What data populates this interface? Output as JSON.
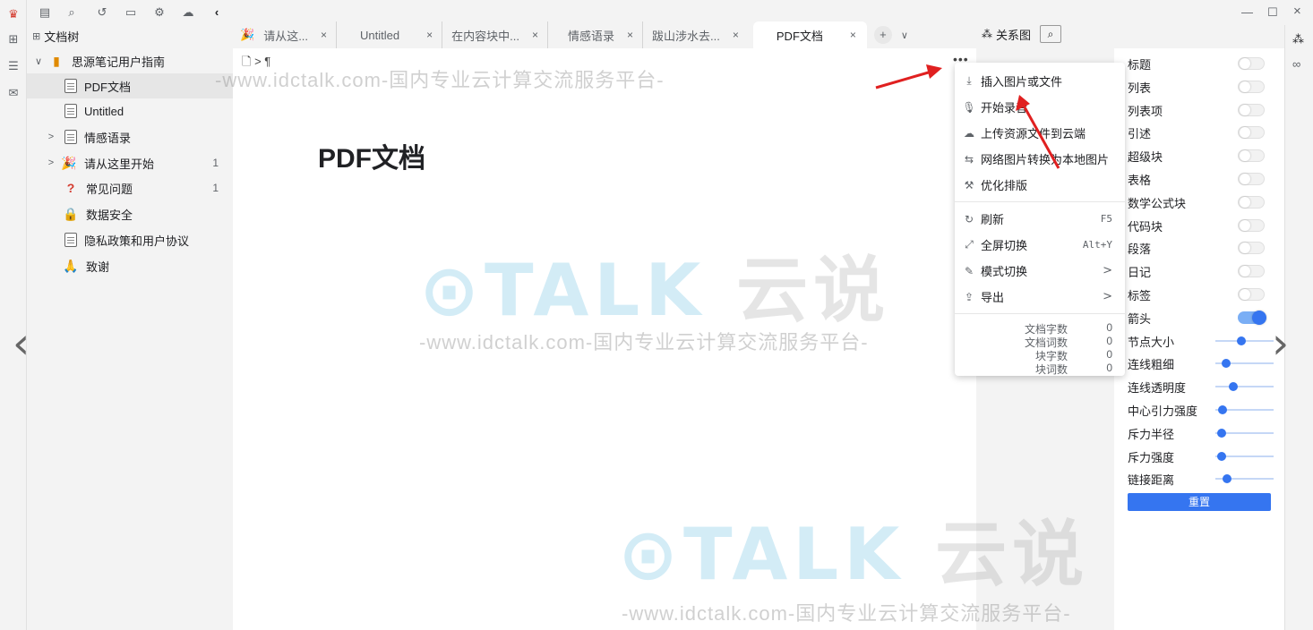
{
  "colors": {
    "accent": "#3575f0",
    "annotation": "#e02020"
  },
  "window": {
    "minimize": "—",
    "maximize": "☐",
    "close": "×"
  },
  "sidebar": {
    "title": "文档树",
    "items": [
      {
        "label": "思源笔记用户指南",
        "icon": "notebook-icon",
        "arrow": "∨",
        "count": ""
      },
      {
        "label": "PDF文档",
        "icon": "doc-icon",
        "arrow": "",
        "count": ""
      },
      {
        "label": "Untitled",
        "icon": "doc-icon",
        "arrow": "",
        "count": ""
      },
      {
        "label": "情感语录",
        "icon": "doc-icon",
        "arrow": ">",
        "count": ""
      },
      {
        "label": "请从这里开始",
        "icon": "party-icon",
        "arrow": ">",
        "count": "1"
      },
      {
        "label": "常见问题",
        "icon": "question-icon",
        "arrow": "",
        "count": "1"
      },
      {
        "label": "数据安全",
        "icon": "lock-icon",
        "arrow": "",
        "count": ""
      },
      {
        "label": "隐私政策和用户协议",
        "icon": "doc-icon",
        "arrow": "",
        "count": ""
      },
      {
        "label": "致谢",
        "icon": "pray-icon",
        "arrow": "",
        "count": ""
      }
    ]
  },
  "tabs": [
    {
      "label": "请从这...",
      "close": "×"
    },
    {
      "label": "Untitled",
      "close": "×"
    },
    {
      "label": "在内容块中...",
      "close": "×"
    },
    {
      "label": "情感语录",
      "close": "×"
    },
    {
      "label": "跋山涉水去...",
      "close": "×"
    },
    {
      "label": "PDF文档",
      "close": "×",
      "active": true
    }
  ],
  "tab_add": "+",
  "tab_more": "∨",
  "editor": {
    "breadcrumb": "🗋 > ¶",
    "title": "PDF文档",
    "more": "•••"
  },
  "watermark": {
    "logo_en": "TALK",
    "logo_cn": "云说",
    "url": "-www.idctalk.com-国内专业云计算交流服务平台-"
  },
  "menu": {
    "items": [
      {
        "label": "插入图片或文件",
        "icon": "⤓",
        "right": ""
      },
      {
        "label": "开始录音",
        "icon": "🎙",
        "right": ""
      },
      {
        "label": "上传资源文件到云端",
        "icon": "☁",
        "right": ""
      },
      {
        "label": "网络图片转换为本地图片",
        "icon": "⇆",
        "right": ""
      },
      {
        "label": "优化排版",
        "icon": "⚒",
        "right": ""
      }
    ],
    "items2": [
      {
        "label": "刷新",
        "icon": "↻",
        "right": "F5"
      },
      {
        "label": "全屏切换",
        "icon": "⤢",
        "right": "Alt+Y"
      },
      {
        "label": "模式切换",
        "icon": "✎",
        "right": ">"
      },
      {
        "label": "导出",
        "icon": "⇪",
        "right": ">"
      }
    ],
    "stats": [
      {
        "label": "文档字数",
        "value": "0"
      },
      {
        "label": "文档词数",
        "value": "0"
      },
      {
        "label": "块字数",
        "value": "0"
      },
      {
        "label": "块词数",
        "value": "0"
      }
    ]
  },
  "graph": {
    "title": "关系图",
    "search": "⌕",
    "toggles": [
      {
        "label": "标题",
        "on": false
      },
      {
        "label": "列表",
        "on": false
      },
      {
        "label": "列表项",
        "on": false
      },
      {
        "label": "引述",
        "on": false
      },
      {
        "label": "超级块",
        "on": false
      },
      {
        "label": "表格",
        "on": false
      },
      {
        "label": "数学公式块",
        "on": false
      },
      {
        "label": "代码块",
        "on": false
      },
      {
        "label": "段落",
        "on": false
      },
      {
        "label": "日记",
        "on": false
      },
      {
        "label": "标签",
        "on": false
      },
      {
        "label": "箭头",
        "on": true
      }
    ],
    "sliders": [
      {
        "label": "节点大小",
        "value": 0.45
      },
      {
        "label": "连线粗细",
        "value": 0.18
      },
      {
        "label": "连线透明度",
        "value": 0.3
      },
      {
        "label": "中心引力强度",
        "value": 0.12
      },
      {
        "label": "斥力半径",
        "value": 0.1
      },
      {
        "label": "斥力强度",
        "value": 0.1
      },
      {
        "label": "链接距离",
        "value": 0.2
      }
    ],
    "reset": "重置"
  }
}
